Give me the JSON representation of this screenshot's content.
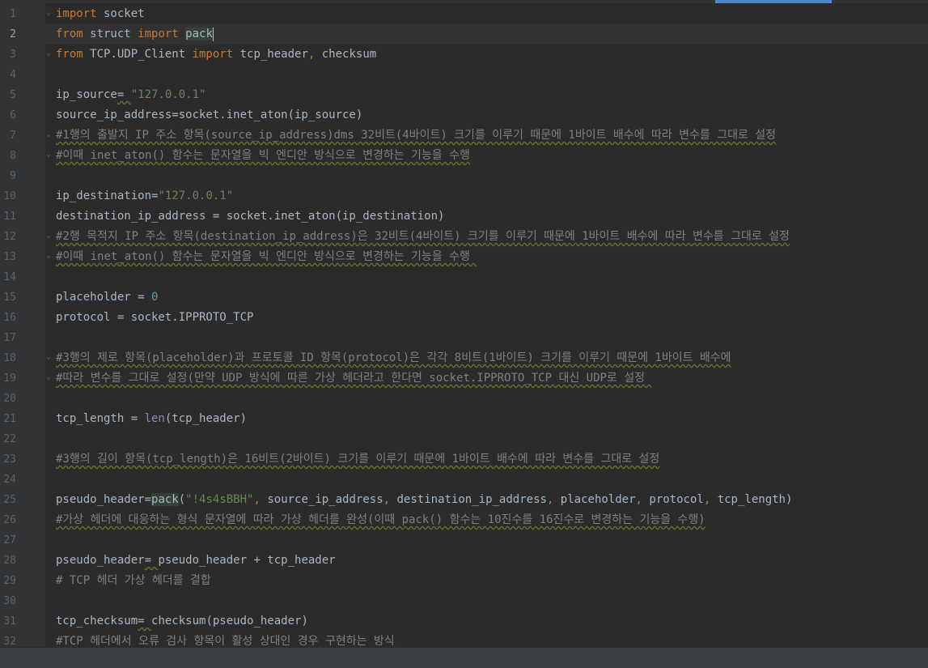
{
  "editor": {
    "current_line": 2,
    "lines": [
      {
        "n": "1",
        "tokens": [
          [
            "kw",
            "import"
          ],
          [
            "t",
            " socket"
          ]
        ],
        "fold": true
      },
      {
        "n": "2",
        "tokens": [
          [
            "kw",
            "from"
          ],
          [
            "t",
            " struct "
          ],
          [
            "kw",
            "import"
          ],
          [
            "t",
            " "
          ],
          [
            "hl",
            "pack"
          ]
        ],
        "caret": true
      },
      {
        "n": "3",
        "tokens": [
          [
            "kw",
            "from"
          ],
          [
            "t",
            " TCP.UDP_Client "
          ],
          [
            "kw",
            "import"
          ],
          [
            "t",
            " tcp_header"
          ],
          [
            "kw",
            ","
          ],
          [
            "t",
            " checksum"
          ]
        ],
        "fold": true
      },
      {
        "n": "4",
        "tokens": []
      },
      {
        "n": "5",
        "tokens": [
          [
            "t",
            "ip_source"
          ],
          [
            "wavy",
            "= "
          ],
          [
            "str",
            "\"127.0.0.1\""
          ]
        ]
      },
      {
        "n": "6",
        "tokens": [
          [
            "t",
            "source_ip_address=socket.inet_aton(ip_source)"
          ]
        ]
      },
      {
        "n": "7",
        "tokens": [
          [
            "cmtw",
            "#1행의 출발지 IP 주소 항목(source_ip_address)dms 32비트(4바이트) 크기를 이루기 때문에 1바이트 배수에 따라 변수를 그대로 설정"
          ]
        ],
        "fold": true
      },
      {
        "n": "8",
        "tokens": [
          [
            "cmtw",
            "#이때 inet_aton() 함수는 문자열을 빅 엔디안 방식으로 변경하는 기능을 수행"
          ]
        ],
        "fold": true
      },
      {
        "n": "9",
        "tokens": []
      },
      {
        "n": "10",
        "tokens": [
          [
            "t",
            "ip_destination="
          ],
          [
            "str",
            "\"127.0.0.1\""
          ]
        ]
      },
      {
        "n": "11",
        "tokens": [
          [
            "t",
            "destination_ip_address = socket.inet_aton(ip_destination)"
          ]
        ]
      },
      {
        "n": "12",
        "tokens": [
          [
            "cmtw",
            "#2행 목적지 IP 주소 항목(destination_ip_address)은 32비트(4바이트) 크기를 이루기 때문에 1바이트 배수에 따라 변수를 그대로 설정"
          ]
        ],
        "fold": true
      },
      {
        "n": "13",
        "tokens": [
          [
            "cmtw",
            "#이때 inet_aton() 함수는 문자열을 빅 엔디안 방식으로 변경하는 기능을 수행 "
          ]
        ],
        "fold": true
      },
      {
        "n": "14",
        "tokens": []
      },
      {
        "n": "15",
        "tokens": [
          [
            "t",
            "placeholder = "
          ],
          [
            "num",
            "0"
          ]
        ]
      },
      {
        "n": "16",
        "tokens": [
          [
            "t",
            "protocol = socket.IPPROTO_TCP"
          ]
        ]
      },
      {
        "n": "17",
        "tokens": []
      },
      {
        "n": "18",
        "tokens": [
          [
            "cmtw",
            "#3행의 제로 항목(placeholder)과 프로토콜 ID 항목(protocol)은 각각 8비트(1바이트) 크기를 이루기 때문에 1바이트 배수에"
          ]
        ],
        "fold": true
      },
      {
        "n": "19",
        "tokens": [
          [
            "cmtw",
            "#따라 변수를 그대로 설정(만약 UDP 방식에 따른 가상 헤더라고 한다면 socket.IPPROTO_TCP 대신 UDP로 설정 "
          ]
        ],
        "fold": true
      },
      {
        "n": "20",
        "tokens": []
      },
      {
        "n": "21",
        "tokens": [
          [
            "t",
            "tcp_length = "
          ],
          [
            "builtin",
            "len"
          ],
          [
            "t",
            "(tcp_header)"
          ]
        ]
      },
      {
        "n": "22",
        "tokens": []
      },
      {
        "n": "23",
        "tokens": [
          [
            "cmtw",
            "#3행의 길이 항목(tcp_length)은 16비트(2바이트) 크기를 이루기 때문에 1바이트 배수에 따라 변수를 그대로 설정"
          ]
        ]
      },
      {
        "n": "24",
        "tokens": []
      },
      {
        "n": "25",
        "tokens": [
          [
            "t",
            "pseudo_header="
          ],
          [
            "hl",
            "pack"
          ],
          [
            "t",
            "("
          ],
          [
            "str",
            "\"!4s4sBBH\""
          ],
          [
            "kw",
            ","
          ],
          [
            "t",
            " source_ip_address"
          ],
          [
            "kw",
            ","
          ],
          [
            "t",
            " destination_ip_address"
          ],
          [
            "kw",
            ","
          ],
          [
            "t",
            " placeholder"
          ],
          [
            "kw",
            ","
          ],
          [
            "t",
            " protocol"
          ],
          [
            "kw",
            ","
          ],
          [
            "t",
            " tcp_length)"
          ]
        ]
      },
      {
        "n": "26",
        "tokens": [
          [
            "cmtw",
            "#가상 헤더에 대응하는 형식 문자열에 따라 가상 헤더를 완성(이때 pack() 함수는 10진수를 16진수로 변경하는 기능을 수행)"
          ]
        ]
      },
      {
        "n": "27",
        "tokens": []
      },
      {
        "n": "28",
        "tokens": [
          [
            "t",
            "pseudo_header"
          ],
          [
            "wavy",
            "= "
          ],
          [
            "t",
            "pseudo_header + tcp_header"
          ]
        ]
      },
      {
        "n": "29",
        "tokens": [
          [
            "cmt",
            "# TCP 헤더 가상 헤더를 결합"
          ]
        ]
      },
      {
        "n": "30",
        "tokens": []
      },
      {
        "n": "31",
        "tokens": [
          [
            "t",
            "tcp_checksum"
          ],
          [
            "wavy",
            "= "
          ],
          [
            "t",
            "checksum(pseudo_header)"
          ]
        ]
      },
      {
        "n": "32",
        "tokens": [
          [
            "cmtw",
            "#TCP 헤더에서 오류 검사 항목이 활성 상대인 경우 구현하는 방식 "
          ]
        ]
      }
    ]
  }
}
